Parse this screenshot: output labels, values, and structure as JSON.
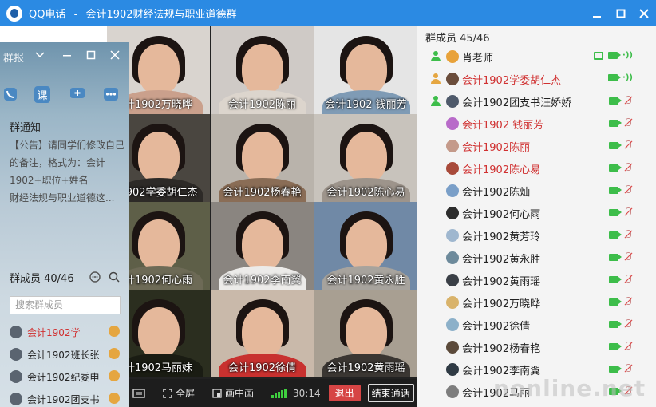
{
  "window": {
    "app_name": "QQ电话",
    "separator": "-",
    "group_name": "会计1902财经法规与职业道德群",
    "minimize_icon": "minimize-icon",
    "maximize_icon": "maximize-icon",
    "close_icon": "close-icon"
  },
  "video_grid": [
    {
      "name": "计1902万晓晔",
      "bg": "#d9d4cf",
      "body": "#caa08c"
    },
    {
      "name": "会计1902陈丽",
      "bg": "#cfcac6",
      "body": "#dcd5cd"
    },
    {
      "name": "会计1902 钱丽芳",
      "bg": "#e5e5e5",
      "body": "#7f9bb5"
    },
    {
      "name": "1902学委胡仁杰",
      "bg": "#4a4640",
      "body": "#2d2a27"
    },
    {
      "name": "会计1902杨春艳",
      "bg": "#b9b3ab",
      "body": "#8a6d56"
    },
    {
      "name": "会计1902陈心易",
      "bg": "#c8c3bc",
      "body": "#9d948b"
    },
    {
      "name": "计1902何心雨",
      "bg": "#5e5f48",
      "body": "#6d6a56"
    },
    {
      "name": "会计1902李南翼",
      "bg": "#8a8580",
      "body": "#ecebe9"
    },
    {
      "name": "会计1902黄永胜",
      "bg": "#7089a6",
      "body": "#a7a39d"
    },
    {
      "name": "计1902马丽妹",
      "bg": "#2b2e1f",
      "body": "#1a1c13"
    },
    {
      "name": "会计1902徐倩",
      "bg": "#c9b9aa",
      "body": "#c8312f"
    },
    {
      "name": "会计1902黄雨瑶",
      "bg": "#a89f92",
      "body": "#3a3632"
    }
  ],
  "controls": {
    "fullscreen_label": "全屏",
    "pip_label": "画中画",
    "duration": "30:14",
    "exit_label": "退出",
    "end_call_label": "结束通话"
  },
  "left_panel": {
    "mode_label": "群报",
    "tools": [
      "phone-icon",
      "课",
      "chat-icon",
      "more-icon"
    ],
    "notice_title": "群通知",
    "notice_lines": [
      "【公告】请同学们修改自己",
      "的备注，格式为：会计",
      "1902+职位+姓名",
      "财经法规与职业道德这..."
    ],
    "members_label": "群成员 40/46",
    "search_placeholder": "搜索群成员",
    "members": [
      {
        "name": "会计1902学",
        "color": "#d03030"
      },
      {
        "name": "会计1902班长张",
        "color": "#222222"
      },
      {
        "name": "会计1902纪委申",
        "color": "#222222"
      },
      {
        "name": "会计1902团支书",
        "color": "#222222"
      }
    ]
  },
  "right_panel": {
    "header": "群成员 45/46",
    "members": [
      {
        "name": "肖老师",
        "color": "#222222",
        "role": "owner",
        "av": "#e8a23a",
        "mic_on": true,
        "screen": true
      },
      {
        "name": "会计1902学委胡仁杰",
        "color": "#d03030",
        "role": "admin",
        "av": "#6b4d3b",
        "mic_on": true,
        "screen": false
      },
      {
        "name": "会计1902团支书汪娇娇",
        "color": "#222222",
        "role": "admin",
        "av": "#4f5a6b",
        "mic_on": false,
        "screen": false
      },
      {
        "name": "会计1902 钱丽芳",
        "color": "#d03030",
        "role": "",
        "av": "#b86bc9",
        "mic_on": false,
        "screen": false
      },
      {
        "name": "会计1902陈丽",
        "color": "#d03030",
        "role": "",
        "av": "#c49a8a",
        "mic_on": false,
        "screen": false
      },
      {
        "name": "会计1902陈心易",
        "color": "#d03030",
        "role": "",
        "av": "#a84a3a",
        "mic_on": false,
        "screen": false
      },
      {
        "name": "会计1902陈灿",
        "color": "#222222",
        "role": "",
        "av": "#7a9fc8",
        "mic_on": false,
        "screen": false
      },
      {
        "name": "会计1902何心雨",
        "color": "#222222",
        "role": "",
        "av": "#2d2d2d",
        "mic_on": false,
        "screen": false
      },
      {
        "name": "会计1902黄芳玲",
        "color": "#222222",
        "role": "",
        "av": "#9fb7cf",
        "mic_on": false,
        "screen": false
      },
      {
        "name": "会计1902黄永胜",
        "color": "#222222",
        "role": "",
        "av": "#6d8a9b",
        "mic_on": false,
        "screen": false
      },
      {
        "name": "会计1902黄雨瑶",
        "color": "#222222",
        "role": "",
        "av": "#3a3f46",
        "mic_on": false,
        "screen": false
      },
      {
        "name": "会计1902万晓晔",
        "color": "#222222",
        "role": "",
        "av": "#d9b36b",
        "mic_on": false,
        "screen": false
      },
      {
        "name": "会计1902徐倩",
        "color": "#222222",
        "role": "",
        "av": "#8cb0c9",
        "mic_on": false,
        "screen": false
      },
      {
        "name": "会计1902杨春艳",
        "color": "#222222",
        "role": "",
        "av": "#5b4a3a",
        "mic_on": false,
        "screen": false
      },
      {
        "name": "会计1902李南翼",
        "color": "#222222",
        "role": "",
        "av": "#2f3a44",
        "mic_on": false,
        "screen": false
      },
      {
        "name": "会计1902马丽",
        "color": "#222222",
        "role": "",
        "av": "#7d7d7d",
        "mic_on": false,
        "screen": false
      }
    ]
  },
  "watermark": "nonline.net"
}
